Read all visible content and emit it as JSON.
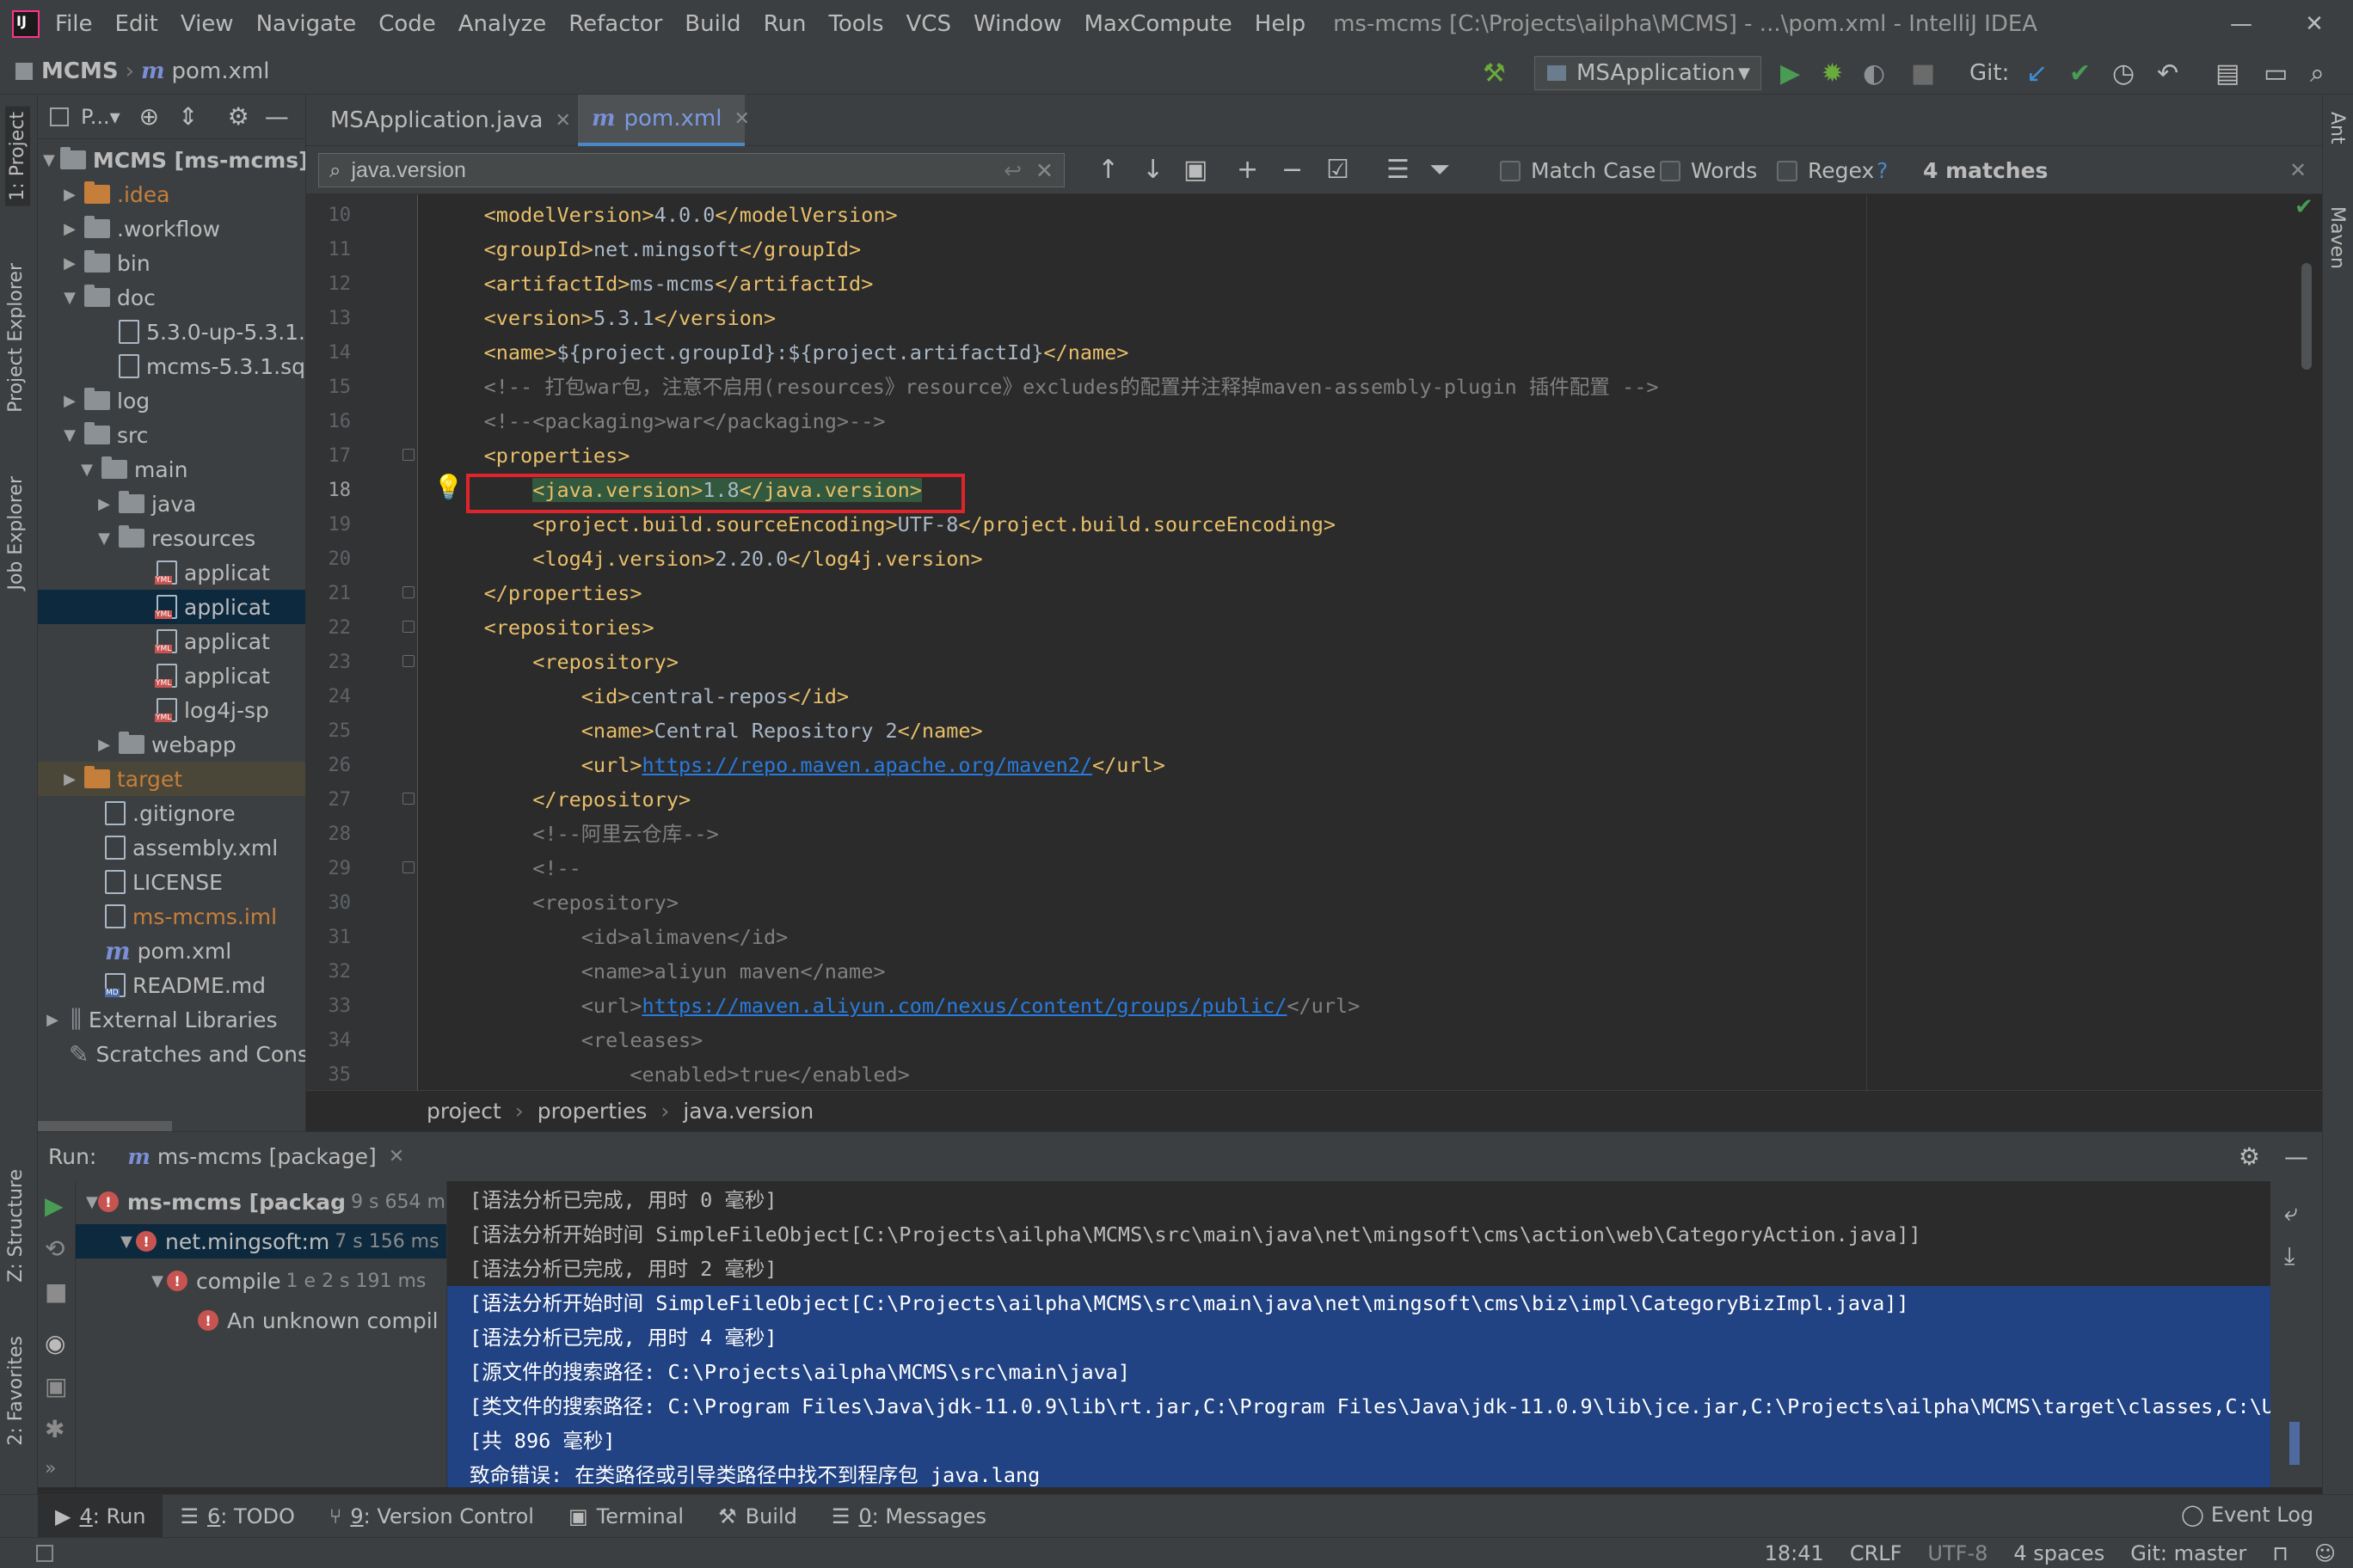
{
  "menu": [
    "File",
    "Edit",
    "View",
    "Navigate",
    "Code",
    "Analyze",
    "Refactor",
    "Build",
    "Run",
    "Tools",
    "VCS",
    "Window",
    "MaxCompute",
    "Help"
  ],
  "window_title": "ms-mcms [C:\\Projects\\ailpha\\MCMS] - ...\\pom.xml - IntelliJ IDEA",
  "nav": {
    "project": "MCMS",
    "file": "pom.xml",
    "m": "m"
  },
  "run_config": "MSApplication",
  "git_label": "Git:",
  "side_tabs": {
    "project": "1: Project",
    "project_explorer": "Project Explorer",
    "job_explorer": "Job Explorer",
    "structure": "Z: Structure",
    "favorites": "2: Favorites",
    "ant": "Ant",
    "maven": "Maven"
  },
  "project_panel": {
    "title": "P...▾",
    "tree": [
      {
        "label": "MCMS [ms-mcms]",
        "indent": 0,
        "arrow": "▼",
        "icon": "folder",
        "bold": true
      },
      {
        "label": ".idea",
        "indent": 1,
        "arrow": "▶",
        "icon": "folder-orange",
        "color": "#c57f3a"
      },
      {
        "label": ".workflow",
        "indent": 1,
        "arrow": "▶",
        "icon": "folder"
      },
      {
        "label": "bin",
        "indent": 1,
        "arrow": "▶",
        "icon": "folder"
      },
      {
        "label": "doc",
        "indent": 1,
        "arrow": "▼",
        "icon": "folder"
      },
      {
        "label": "5.3.0-up-5.3.1.",
        "indent": 3,
        "arrow": "",
        "icon": "file"
      },
      {
        "label": "mcms-5.3.1.sq",
        "indent": 3,
        "arrow": "",
        "icon": "file"
      },
      {
        "label": "log",
        "indent": 1,
        "arrow": "▶",
        "icon": "folder"
      },
      {
        "label": "src",
        "indent": 1,
        "arrow": "▼",
        "icon": "folder"
      },
      {
        "label": "main",
        "indent": 2,
        "arrow": "▼",
        "icon": "folder"
      },
      {
        "label": "java",
        "indent": 3,
        "arrow": "▶",
        "icon": "folder"
      },
      {
        "label": "resources",
        "indent": 3,
        "arrow": "▼",
        "icon": "folder"
      },
      {
        "label": "applicat",
        "indent": 5,
        "arrow": "",
        "icon": "yml"
      },
      {
        "label": "applicat",
        "indent": 5,
        "arrow": "",
        "icon": "yml",
        "selected": true
      },
      {
        "label": "applicat",
        "indent": 5,
        "arrow": "",
        "icon": "yml"
      },
      {
        "label": "applicat",
        "indent": 5,
        "arrow": "",
        "icon": "yml"
      },
      {
        "label": "log4j-sp",
        "indent": 5,
        "arrow": "",
        "icon": "yml"
      },
      {
        "label": "webapp",
        "indent": 3,
        "arrow": "▶",
        "icon": "folder"
      },
      {
        "label": "target",
        "indent": 1,
        "arrow": "▶",
        "icon": "folder-orange",
        "color": "#c57f3a",
        "highlight": true
      },
      {
        "label": ".gitignore",
        "indent": 2,
        "arrow": "",
        "icon": "file"
      },
      {
        "label": "assembly.xml",
        "indent": 2,
        "arrow": "",
        "icon": "file"
      },
      {
        "label": "LICENSE",
        "indent": 2,
        "arrow": "",
        "icon": "file"
      },
      {
        "label": "ms-mcms.iml",
        "indent": 2,
        "arrow": "",
        "icon": "file",
        "color": "#c57f3a"
      },
      {
        "label": "pom.xml",
        "indent": 2,
        "arrow": "",
        "icon": "maven"
      },
      {
        "label": "README.md",
        "indent": 2,
        "arrow": "",
        "icon": "md"
      },
      {
        "label": "External Libraries",
        "indent": 0,
        "arrow": "▶",
        "icon": "lib"
      },
      {
        "label": "Scratches and Consc",
        "indent": 1,
        "arrow": "",
        "icon": "scratch"
      }
    ]
  },
  "editor_tabs": [
    {
      "label": "MSApplication.java",
      "active": false
    },
    {
      "label": "pom.xml",
      "active": true
    }
  ],
  "find": {
    "query": "java.version",
    "match_case": "Match Case",
    "words": "Words",
    "regex": "Regex",
    "help": "?",
    "matches": "4 matches"
  },
  "code_lines": [
    {
      "n": "10",
      "parts": [
        [
          "    ",
          "txt"
        ],
        [
          "<modelVersion>",
          "t"
        ],
        [
          "4.0.0",
          "txt"
        ],
        [
          "</modelVersion>",
          "t"
        ]
      ]
    },
    {
      "n": "11",
      "parts": [
        [
          "    ",
          "txt"
        ],
        [
          "<groupId>",
          "t"
        ],
        [
          "net.mingsoft",
          "txt"
        ],
        [
          "</groupId>",
          "t"
        ]
      ]
    },
    {
      "n": "12",
      "parts": [
        [
          "    ",
          "txt"
        ],
        [
          "<artifactId>",
          "t"
        ],
        [
          "ms-mcms",
          "txt"
        ],
        [
          "</artifactId>",
          "t"
        ]
      ]
    },
    {
      "n": "13",
      "parts": [
        [
          "    ",
          "txt"
        ],
        [
          "<version>",
          "t"
        ],
        [
          "5.3.1",
          "txt"
        ],
        [
          "</version>",
          "t"
        ]
      ]
    },
    {
      "n": "14",
      "parts": [
        [
          "    ",
          "txt"
        ],
        [
          "<name>",
          "t"
        ],
        [
          "${project.groupId}:${project.artifactId}",
          "txt"
        ],
        [
          "</name>",
          "t"
        ]
      ]
    },
    {
      "n": "15",
      "parts": [
        [
          "    ",
          "txt"
        ],
        [
          "<!-- 打包war包，注意不启用(resources》resource》excludes的配置并注释掉maven-assembly-plugin 插件配置 -->",
          "cm"
        ]
      ]
    },
    {
      "n": "16",
      "parts": [
        [
          "    ",
          "txt"
        ],
        [
          "<!--<packaging>war</packaging>-->",
          "cm"
        ]
      ]
    },
    {
      "n": "17",
      "parts": [
        [
          "    ",
          "txt"
        ],
        [
          "<properties>",
          "t"
        ]
      ]
    },
    {
      "n": "18",
      "parts": [
        [
          "        ",
          "txt"
        ],
        [
          "<java.version>",
          "t"
        ],
        [
          "1.8",
          "txt"
        ],
        [
          "</java.version>",
          "t"
        ]
      ]
    },
    {
      "n": "19",
      "parts": [
        [
          "        ",
          "txt"
        ],
        [
          "<project.build.sourceEncoding>",
          "t"
        ],
        [
          "UTF-8",
          "txt"
        ],
        [
          "</project.build.sourceEncoding>",
          "t"
        ]
      ]
    },
    {
      "n": "20",
      "parts": [
        [
          "        ",
          "txt"
        ],
        [
          "<log4j.version>",
          "t"
        ],
        [
          "2.20.0",
          "txt"
        ],
        [
          "</log4j.version>",
          "t"
        ]
      ]
    },
    {
      "n": "21",
      "parts": [
        [
          "    ",
          "txt"
        ],
        [
          "</properties>",
          "t"
        ]
      ]
    },
    {
      "n": "22",
      "parts": [
        [
          "    ",
          "txt"
        ],
        [
          "<repositories>",
          "t"
        ]
      ]
    },
    {
      "n": "23",
      "parts": [
        [
          "        ",
          "txt"
        ],
        [
          "<repository>",
          "t"
        ]
      ]
    },
    {
      "n": "24",
      "parts": [
        [
          "            ",
          "txt"
        ],
        [
          "<id>",
          "t"
        ],
        [
          "central-repos",
          "txt"
        ],
        [
          "</id>",
          "t"
        ]
      ]
    },
    {
      "n": "25",
      "parts": [
        [
          "            ",
          "txt"
        ],
        [
          "<name>",
          "t"
        ],
        [
          "Central Repository 2",
          "txt"
        ],
        [
          "</name>",
          "t"
        ]
      ]
    },
    {
      "n": "26",
      "parts": [
        [
          "            ",
          "txt"
        ],
        [
          "<url>",
          "t"
        ],
        [
          "https://repo.maven.apache.org/maven2/",
          "url"
        ],
        [
          "</url>",
          "t"
        ]
      ]
    },
    {
      "n": "27",
      "parts": [
        [
          "        ",
          "txt"
        ],
        [
          "</repository>",
          "t"
        ]
      ]
    },
    {
      "n": "28",
      "parts": [
        [
          "        ",
          "txt"
        ],
        [
          "<!--阿里云仓库-->",
          "cm"
        ]
      ]
    },
    {
      "n": "29",
      "parts": [
        [
          "        ",
          "txt"
        ],
        [
          "<!--",
          "cm"
        ]
      ]
    },
    {
      "n": "30",
      "parts": [
        [
          "        ",
          "txt"
        ],
        [
          "<repository>",
          "cm"
        ]
      ]
    },
    {
      "n": "31",
      "parts": [
        [
          "            ",
          "txt"
        ],
        [
          "<id>alimaven</id>",
          "cm"
        ]
      ]
    },
    {
      "n": "32",
      "parts": [
        [
          "            ",
          "txt"
        ],
        [
          "<name>aliyun maven</name>",
          "cm"
        ]
      ]
    },
    {
      "n": "33",
      "parts": [
        [
          "            ",
          "txt"
        ],
        [
          "<url>",
          "cm"
        ],
        [
          "https://maven.aliyun.com/nexus/content/groups/public/",
          "url"
        ],
        [
          "</url>",
          "cm"
        ]
      ]
    },
    {
      "n": "34",
      "parts": [
        [
          "            ",
          "txt"
        ],
        [
          "<releases>",
          "cm"
        ]
      ]
    },
    {
      "n": "35",
      "parts": [
        [
          "                ",
          "txt"
        ],
        [
          "<enabled>true</enabled>",
          "cm"
        ]
      ]
    }
  ],
  "breadcrumb": [
    "project",
    "properties",
    "java.version"
  ],
  "run": {
    "label": "Run:",
    "tab": "ms-mcms [package]",
    "tree": [
      {
        "label": "ms-mcms [packag",
        "time": "9 s 654 ms",
        "indent": 0,
        "arrow": "▼",
        "bold": true
      },
      {
        "label": "net.mingsoft:m",
        "time": "7 s 156 ms",
        "indent": 1,
        "arrow": "▼",
        "selected": true
      },
      {
        "label": "compile",
        "time": "1 e 2 s 191 ms",
        "indent": 2,
        "arrow": "▼"
      },
      {
        "label": "An unknown compil",
        "time": "",
        "indent": 3,
        "arrow": ""
      }
    ],
    "console": [
      {
        "text": "[语法分析已完成, 用时 0 毫秒]",
        "sel": false
      },
      {
        "text": "[语法分析开始时间 SimpleFileObject[C:\\Projects\\ailpha\\MCMS\\src\\main\\java\\net\\mingsoft\\cms\\action\\web\\CategoryAction.java]]",
        "sel": false
      },
      {
        "text": "[语法分析已完成, 用时 2 毫秒]",
        "sel": false
      },
      {
        "text": "[语法分析开始时间 SimpleFileObject[C:\\Projects\\ailpha\\MCMS\\src\\main\\java\\net\\mingsoft\\cms\\biz\\impl\\CategoryBizImpl.java]]",
        "sel": true
      },
      {
        "text": "[语法分析已完成, 用时 4 毫秒]",
        "sel": true
      },
      {
        "text": "[源文件的搜索路径: C:\\Projects\\ailpha\\MCMS\\src\\main\\java]",
        "sel": true
      },
      {
        "text": "[类文件的搜索路径: C:\\Program Files\\Java\\jdk-11.0.9\\lib\\rt.jar,C:\\Program Files\\Java\\jdk-11.0.9\\lib\\jce.jar,C:\\Projects\\ailpha\\MCMS\\target\\classes,C:\\U",
        "sel": true
      },
      {
        "text": "[共 896 毫秒]",
        "sel": true
      },
      {
        "text": "致命错误: 在类路径或引导类路径中找不到程序包 java.lang",
        "sel": true
      }
    ]
  },
  "bottom_tabs": [
    {
      "prefix": "4",
      "label": ": Run",
      "icon": "▶",
      "active": true
    },
    {
      "prefix": "6",
      "label": ": TODO",
      "icon": "☰"
    },
    {
      "prefix": "9",
      "label": ": Version Control",
      "icon": "⑂"
    },
    {
      "prefix": "",
      "label": "Terminal",
      "icon": "▣"
    },
    {
      "prefix": "",
      "label": "Build",
      "icon": "⚒"
    },
    {
      "prefix": "0",
      "label": ": Messages",
      "icon": "☰"
    }
  ],
  "event_log": "Event Log",
  "status": {
    "pos": "18:41",
    "le": "CRLF",
    "enc": "UTF-8",
    "indent": "4 spaces",
    "git": "Git: master"
  },
  "colors": {
    "accent": "#4a88c7",
    "highlight_box": "#e0242c",
    "tag": "#e8bf6a",
    "selection": "#214283"
  }
}
